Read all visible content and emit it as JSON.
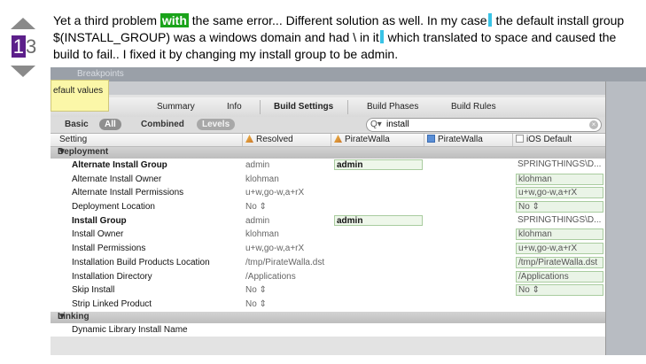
{
  "vote": {
    "count_prefix": "1",
    "count_suffix": "3"
  },
  "answer": {
    "p1": "Yet a third problem ",
    "kw": "with",
    "p2": " the same error... Different solution as well. In my case",
    "p3": " the default install group $(INSTALL_GROUP) was a windows domain and had \\ in it",
    "p4": " which translated to space and caused the build to fail.. I fixed it by changing my install group to be admin."
  },
  "screenshot": {
    "titlebar": "Breakpoints",
    "tooltip": "efault values",
    "tabs": [
      "Summary",
      "Info",
      "Build Settings",
      "Build Phases",
      "Build Rules"
    ],
    "active_tab": "Build Settings",
    "filter": {
      "basic": "Basic",
      "all": "All",
      "combined": "Combined",
      "levels": "Levels"
    },
    "search": {
      "value": "install",
      "glass": "Q▾"
    },
    "columns": {
      "setting": "Setting",
      "resolved": "Resolved",
      "target": "PirateWalla",
      "project": "PirateWalla",
      "ios": "iOS Default"
    },
    "sections": {
      "deployment": "Deployment",
      "linking": "Linking"
    },
    "rows": [
      {
        "name": "Alternate Install Group",
        "resolved": "admin",
        "target": "admin",
        "ios": "SPRINGTHINGS\\D..."
      },
      {
        "name": "Alternate Install Owner",
        "resolved": "klohman",
        "target": "",
        "ios": "klohman"
      },
      {
        "name": "Alternate Install Permissions",
        "resolved": "u+w,go-w,a+rX",
        "target": "",
        "ios": "u+w,go-w,a+rX"
      },
      {
        "name": "Deployment Location",
        "resolved": "No ⇕",
        "target": "",
        "ios": "No ⇕"
      },
      {
        "name": "Install Group",
        "resolved": "admin",
        "target": "admin",
        "ios": "SPRINGTHINGS\\D..."
      },
      {
        "name": "Install Owner",
        "resolved": "klohman",
        "target": "",
        "ios": "klohman"
      },
      {
        "name": "Install Permissions",
        "resolved": "u+w,go-w,a+rX",
        "target": "",
        "ios": "u+w,go-w,a+rX"
      },
      {
        "name": "Installation Build Products Location",
        "resolved": "/tmp/PirateWalla.dst",
        "target": "",
        "ios": "/tmp/PirateWalla.dst"
      },
      {
        "name": "Installation Directory",
        "resolved": "/Applications",
        "target": "",
        "ios": "/Applications"
      },
      {
        "name": "Skip Install",
        "resolved": "No ⇕",
        "target": "",
        "ios": "No ⇕"
      },
      {
        "name": "Strip Linked Product",
        "resolved": "No ⇕",
        "target": "",
        "ios": ""
      }
    ],
    "linking_rows": [
      {
        "name": "Dynamic Library Install Name"
      }
    ]
  }
}
